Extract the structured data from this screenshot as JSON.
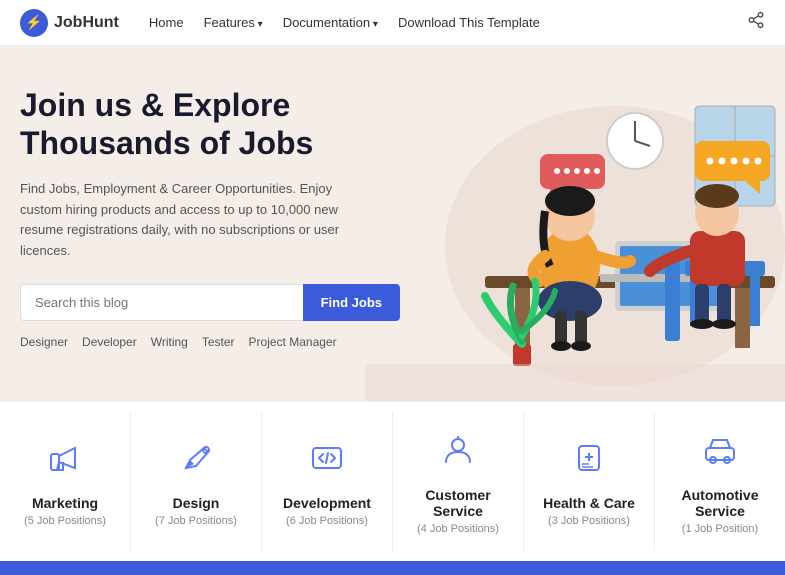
{
  "nav": {
    "logo_text": "JobHunt",
    "logo_icon": "⚡",
    "links": [
      {
        "label": "Home",
        "has_arrow": false
      },
      {
        "label": "Features",
        "has_arrow": true
      },
      {
        "label": "Documentation",
        "has_arrow": true
      },
      {
        "label": "Download This Template",
        "has_arrow": false
      }
    ],
    "share_icon": "share"
  },
  "hero": {
    "title_line1": "Join us & Explore",
    "title_line2": "Thousands of Jobs",
    "description": "Find Jobs, Employment & Career Opportunities. Enjoy custom hiring products and access to up to 10,000 new resume registrations daily, with no subscriptions or user licences.",
    "search_placeholder": "Search this blog",
    "search_button": "Find Jobs",
    "tags": [
      "Designer",
      "Developer",
      "Writing",
      "Tester",
      "Project Manager"
    ]
  },
  "categories": [
    {
      "name": "Marketing",
      "positions": "5 Job Positions",
      "icon": "📣"
    },
    {
      "name": "Design",
      "positions": "7 Job Positions",
      "icon": "✏️"
    },
    {
      "name": "Development",
      "positions": "6 Job Positions",
      "icon": "💻"
    },
    {
      "name": "Customer Service",
      "positions": "4 Job Positions",
      "icon": "👤"
    },
    {
      "name": "Health & Care",
      "positions": "3 Job Positions",
      "icon": "📋"
    },
    {
      "name": "Automotive Service",
      "positions": "1 Job Position",
      "icon": "🔧"
    }
  ]
}
